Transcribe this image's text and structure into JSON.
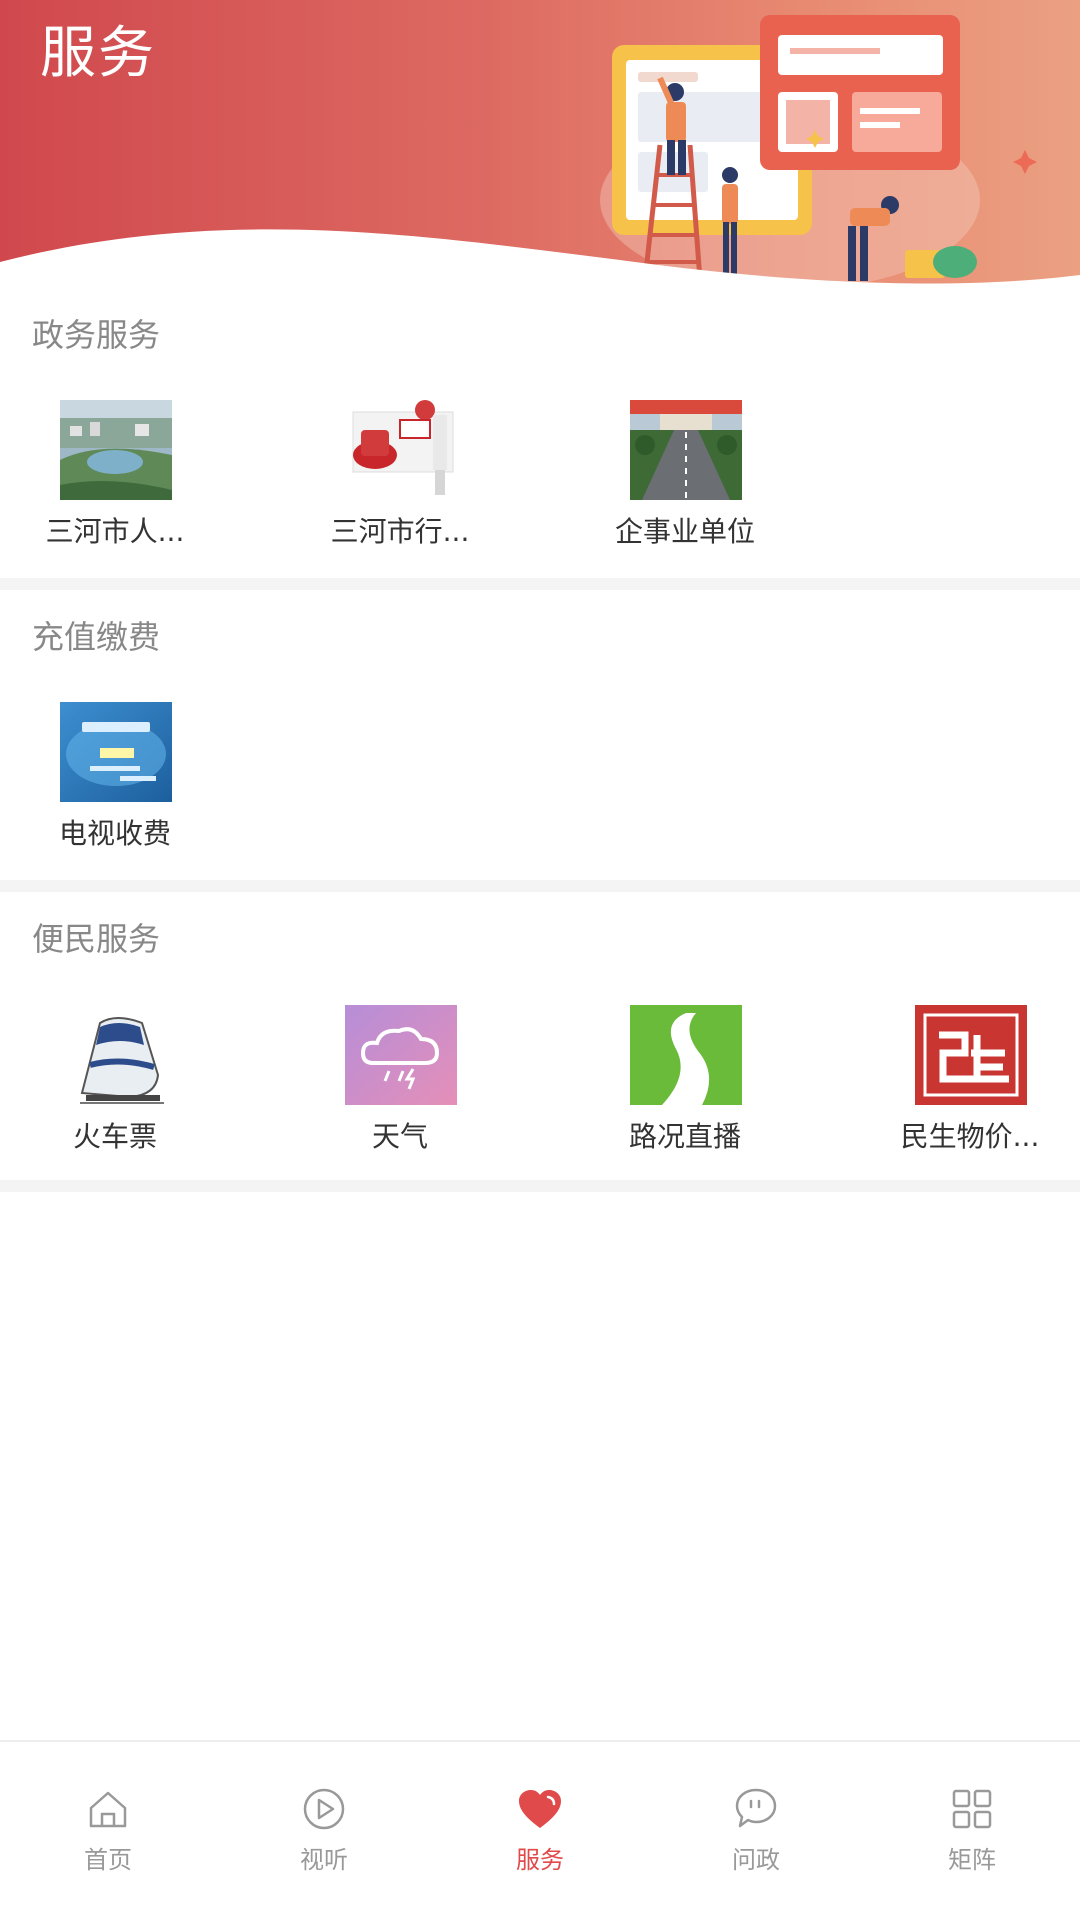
{
  "header": {
    "title": "服务",
    "gradient_start": "#d0484d",
    "gradient_end": "#eba082"
  },
  "sections": [
    {
      "title": "政务服务",
      "items": [
        {
          "label": "三河市人...",
          "icon": "aerial-city-photo"
        },
        {
          "label": "三河市行...",
          "icon": "official-stamp-photo"
        },
        {
          "label": "企事业单位",
          "icon": "boulevard-photo"
        }
      ]
    },
    {
      "title": "充值缴费",
      "items": [
        {
          "label": "电视收费",
          "icon": "tv-payment-photo"
        }
      ]
    },
    {
      "title": "便民服务",
      "items": [
        {
          "label": "火车票",
          "icon": "train-icon"
        },
        {
          "label": "天气",
          "icon": "weather-cloud-icon"
        },
        {
          "label": "路况直播",
          "icon": "road-icon"
        },
        {
          "label": "民生物价...",
          "icon": "minsheng-logo-icon"
        }
      ]
    }
  ],
  "bottom_nav": {
    "items": [
      {
        "label": "首页",
        "icon": "home-icon"
      },
      {
        "label": "视听",
        "icon": "play-icon"
      },
      {
        "label": "服务",
        "icon": "heart-icon"
      },
      {
        "label": "问政",
        "icon": "chat-icon"
      },
      {
        "label": "矩阵",
        "icon": "grid-icon"
      }
    ],
    "active": "服务",
    "active_color": "#e04a4a",
    "inactive_color": "#999999"
  }
}
